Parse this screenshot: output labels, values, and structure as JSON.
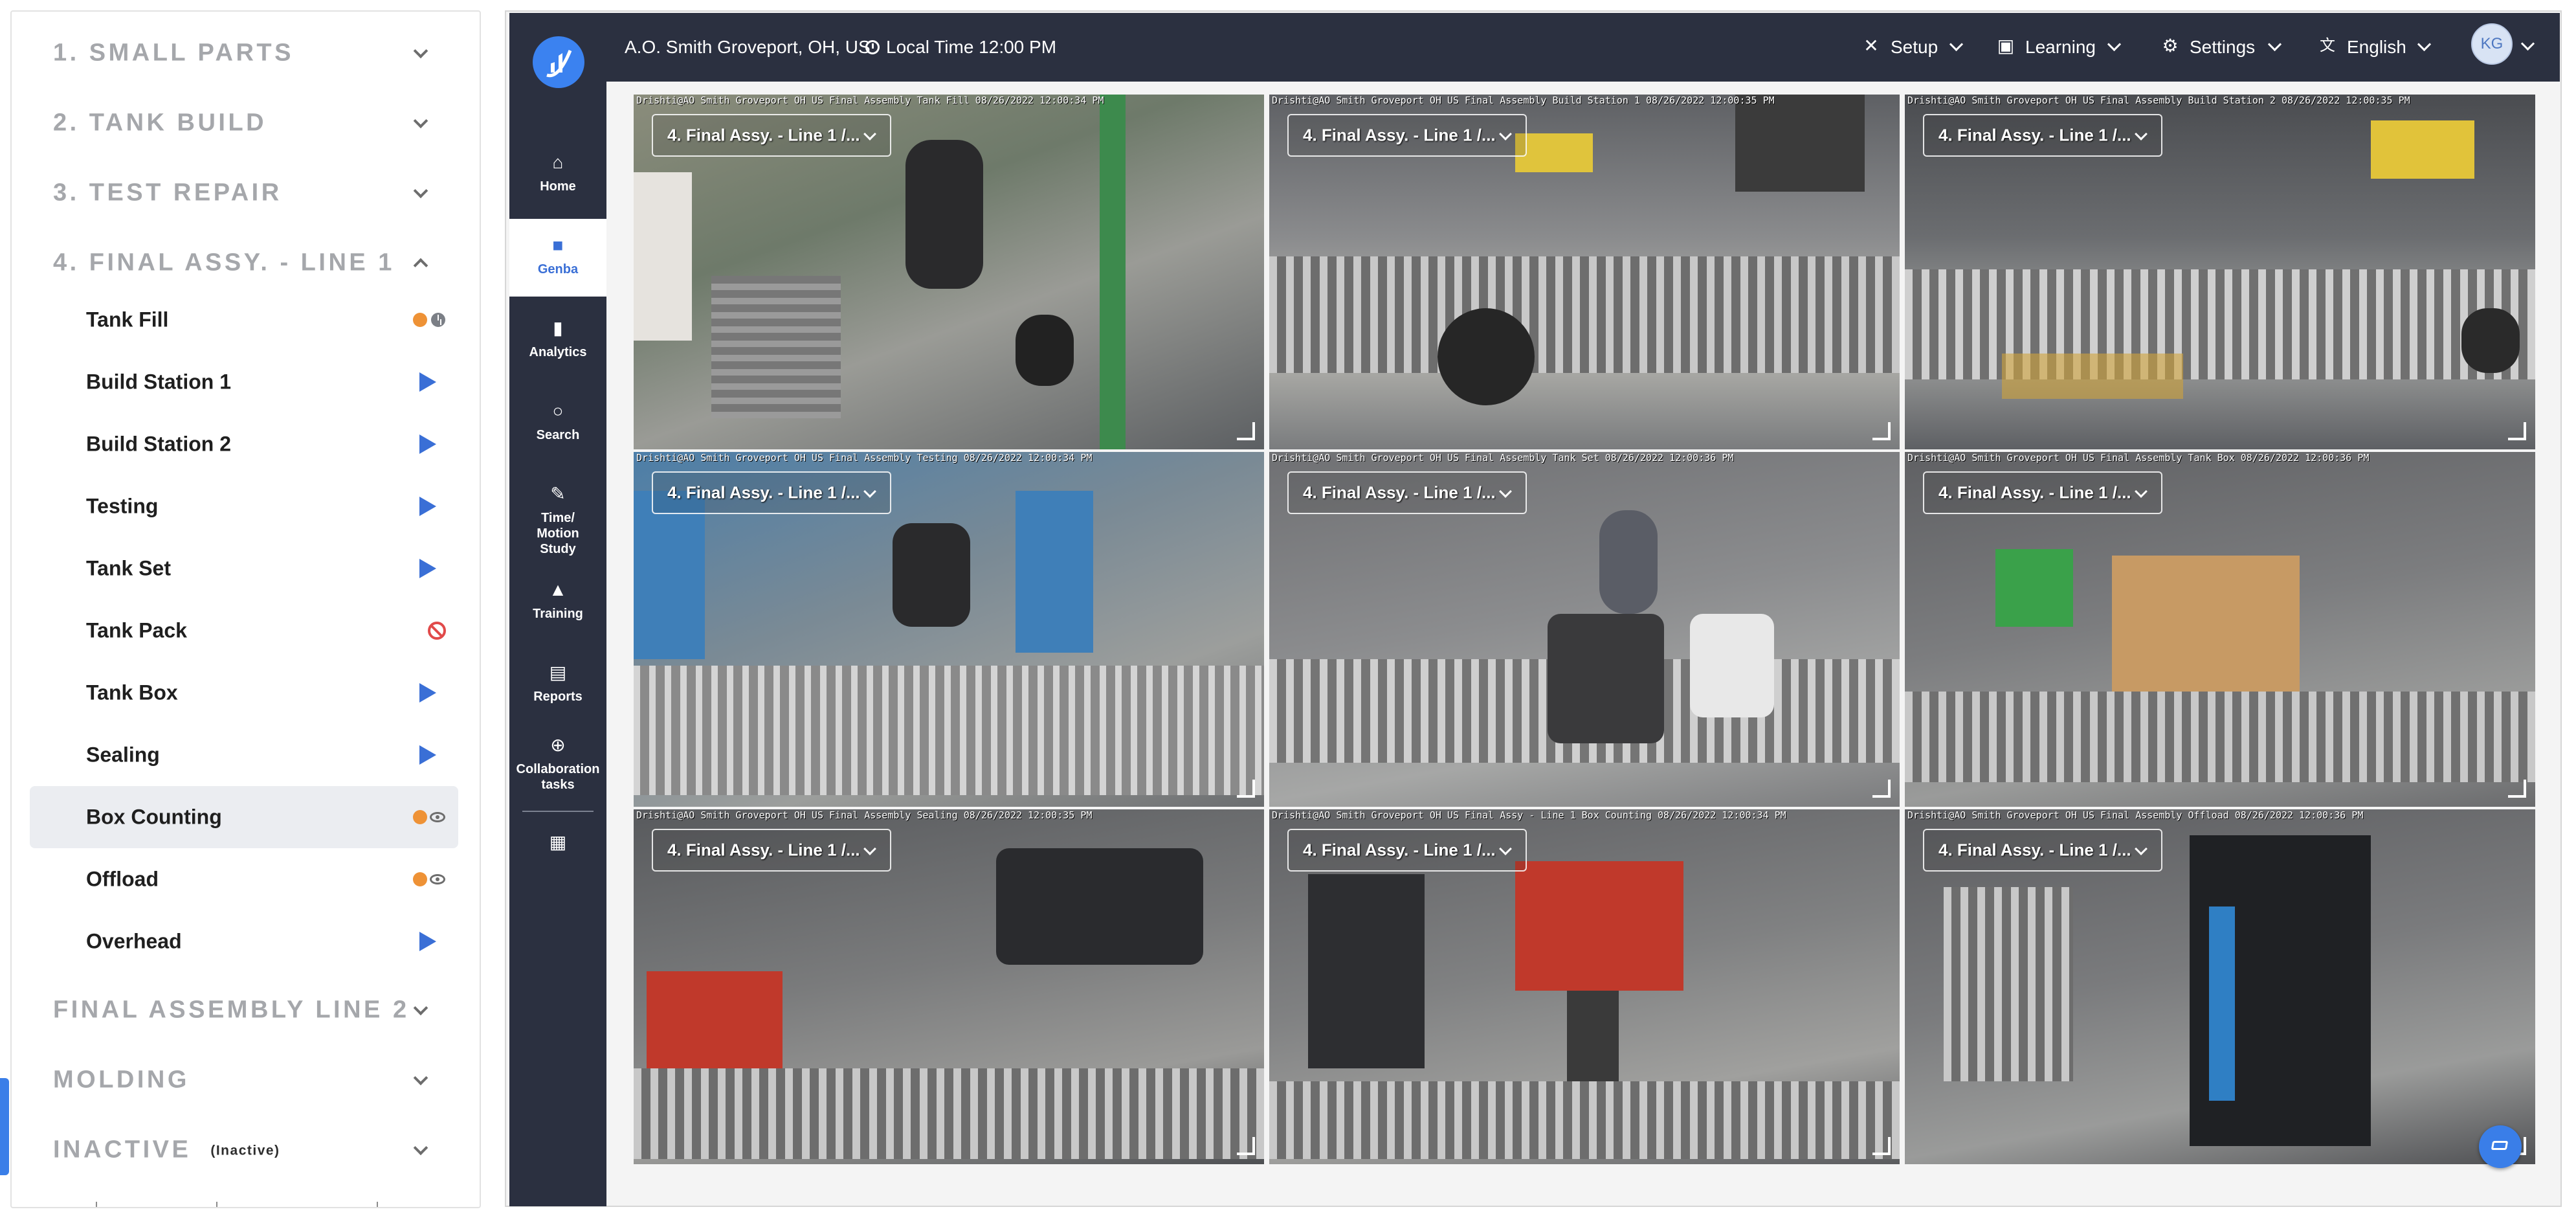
{
  "sidebar": {
    "groups_top": [
      {
        "label": "1. SMALL PARTS"
      },
      {
        "label": "2. TANK BUILD"
      },
      {
        "label": "3. TEST REPAIR"
      },
      {
        "label": "4. FINAL ASSY. - LINE 1"
      }
    ],
    "stations": [
      {
        "label": "Tank Fill",
        "status": "orange-dot+clock-icon"
      },
      {
        "label": "Build Station 1",
        "status": "play-icon"
      },
      {
        "label": "Build Station 2",
        "status": "play-icon"
      },
      {
        "label": "Testing",
        "status": "play-icon"
      },
      {
        "label": "Tank Set",
        "status": "play-icon"
      },
      {
        "label": "Tank Pack",
        "status": "ban-icon"
      },
      {
        "label": "Tank Box",
        "status": "play-icon"
      },
      {
        "label": "Sealing",
        "status": "play-icon"
      },
      {
        "label": "Box Counting",
        "status": "orange-dot+eye-icon",
        "selected": true
      },
      {
        "label": "Offload",
        "status": "orange-dot+eye-icon"
      },
      {
        "label": "Overhead",
        "status": "play-icon"
      }
    ],
    "groups_bottom": [
      {
        "label": "FINAL ASSEMBLY LINE 2"
      },
      {
        "label": "MOLDING"
      },
      {
        "label": "INACTIVE",
        "sub": "(Inactive)"
      }
    ]
  },
  "topbar": {
    "location": "A.O. Smith Groveport, OH, US",
    "local_time": "Local Time 12:00 PM",
    "menus": [
      {
        "label": "Setup",
        "icon": "wrench-icon"
      },
      {
        "label": "Learning",
        "icon": "book-icon"
      },
      {
        "label": "Settings",
        "icon": "gear-icon"
      },
      {
        "label": "English",
        "icon": "translate-icon"
      }
    ],
    "user_initials": "KG"
  },
  "nav": [
    {
      "label": "Home",
      "icon": "home-icon"
    },
    {
      "label": "Genba",
      "icon": "video-camera-icon",
      "active": true
    },
    {
      "label": "Analytics",
      "icon": "bar-chart-icon"
    },
    {
      "label": "Search",
      "icon": "search-icon"
    },
    {
      "label": "Time/ Motion Study",
      "icon": "stopwatch-pen-icon"
    },
    {
      "label": "Training",
      "icon": "graduation-cap-icon"
    },
    {
      "label": "Reports",
      "icon": "document-icon"
    },
    {
      "label": "Collaboration tasks",
      "icon": "target-icon"
    }
  ],
  "cameras": [
    {
      "overlay": "Drishti@AO Smith Groveport OH US Final Assembly Tank Fill 08/26/2022 12:00:34 PM",
      "line": "4. Final Assy. - Line 1 /..."
    },
    {
      "overlay": "Drishti@AO Smith Groveport OH US Final Assembly Build Station 1 08/26/2022 12:00:35 PM",
      "line": "4. Final Assy. - Line 1 /..."
    },
    {
      "overlay": "Drishti@AO Smith Groveport OH US Final Assembly Build Station 2 08/26/2022 12:00:35 PM",
      "line": "4. Final Assy. - Line 1 /..."
    },
    {
      "overlay": "Drishti@AO Smith Groveport OH US Final Assembly Testing 08/26/2022 12:00:34 PM",
      "line": "4. Final Assy. - Line 1 /..."
    },
    {
      "overlay": "Drishti@AO Smith Groveport OH US Final Assembly Tank Set 08/26/2022 12:00:36 PM",
      "line": "4. Final Assy. - Line 1 /..."
    },
    {
      "overlay": "Drishti@AO Smith Groveport OH US Final Assembly Tank Box 08/26/2022 12:00:36 PM",
      "line": "4. Final Assy. - Line 1 /..."
    },
    {
      "overlay": "Drishti@AO Smith Groveport OH US Final Assembly Sealing 08/26/2022 12:00:35 PM",
      "line": "4. Final Assy. - Line 1 /..."
    },
    {
      "overlay": "Drishti@AO Smith Groveport OH US Final Assy - Line 1 Box Counting 08/26/2022 12:00:34 PM",
      "line": "4. Final Assy. - Line 1 /..."
    },
    {
      "overlay": "Drishti@AO Smith Groveport OH US Final Assembly Offload 08/26/2022 12:00:36 PM",
      "line": "4. Final Assy. - Line 1 /..."
    }
  ],
  "colors": {
    "sidebar_dark": "#2b3040",
    "accent_blue": "#3a6fd6",
    "status_orange": "#ee9236",
    "status_red": "#e14a4a"
  }
}
